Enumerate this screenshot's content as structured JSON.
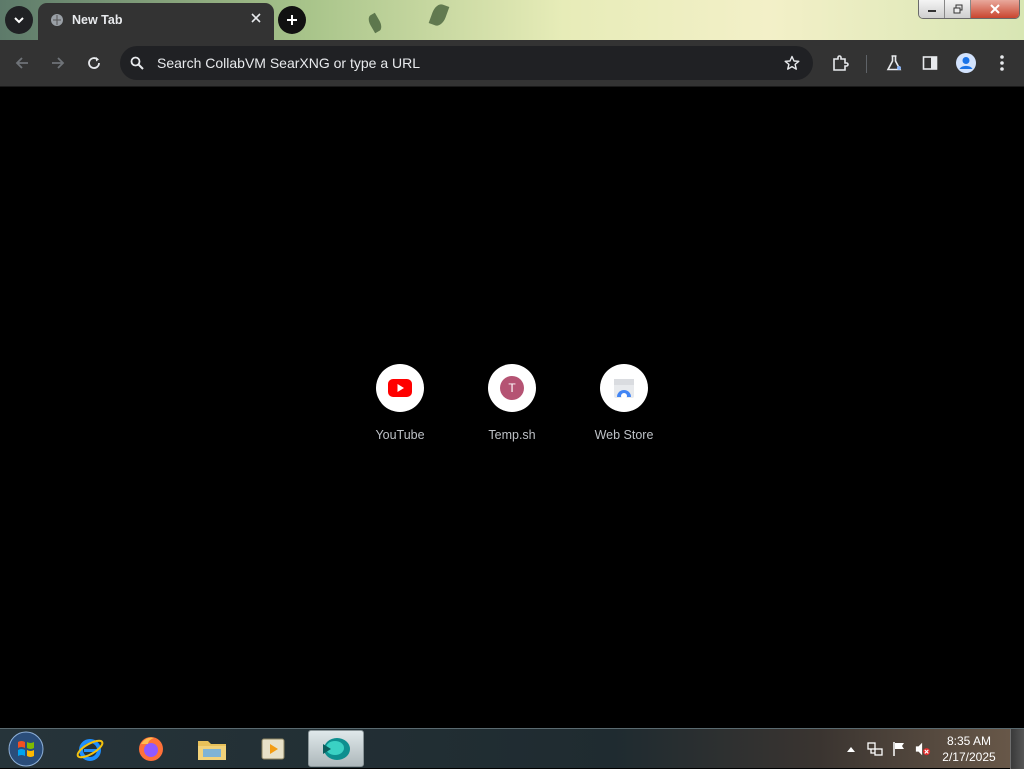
{
  "browser": {
    "tab": {
      "title": "New Tab"
    },
    "omnibox": {
      "placeholder": "Search CollabVM SearXNG or type a URL"
    }
  },
  "shortcuts": [
    {
      "label": "YouTube",
      "icon": "youtube-icon"
    },
    {
      "label": "Temp.sh",
      "icon": "letter-avatar",
      "letter": "T"
    },
    {
      "label": "Web Store",
      "icon": "web-store-icon"
    }
  ],
  "taskbar": {
    "apps": [
      "internet-explorer-icon",
      "firefox-icon",
      "file-explorer-icon",
      "media-player-icon",
      "chrome-active-icon"
    ],
    "clock": {
      "time": "8:35 AM",
      "date": "2/17/2025"
    }
  },
  "colors": {
    "toolbar": "#333333",
    "omnibox": "#202124",
    "page_background": "#000000",
    "youtube_red": "#ff0000",
    "temp_avatar": "#b55373"
  }
}
